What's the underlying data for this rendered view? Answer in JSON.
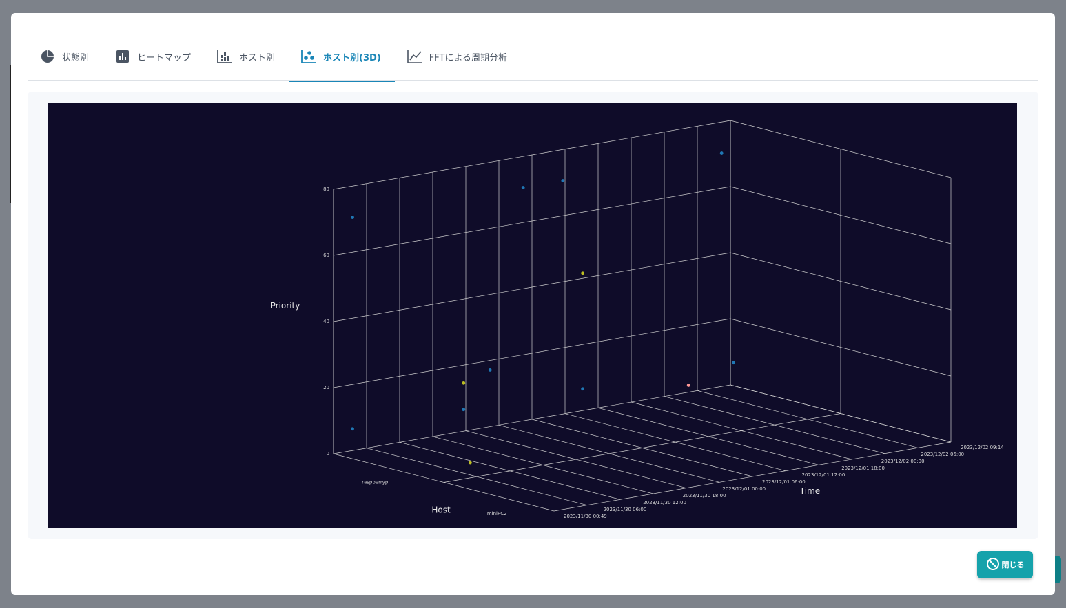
{
  "tabs": [
    {
      "label": "状態別",
      "icon": "pie-chart-icon",
      "active": false
    },
    {
      "label": "ヒートマップ",
      "icon": "bar-chart-icon",
      "active": false
    },
    {
      "label": "ホスト別",
      "icon": "stacked-bar-icon",
      "active": false
    },
    {
      "label": "ホスト別(3D)",
      "icon": "scatter-3d-icon",
      "active": true
    },
    {
      "label": "FFTによる周期分析",
      "icon": "line-chart-icon",
      "active": false
    }
  ],
  "chart_data": {
    "type": "scatter",
    "background": "#0f0c29",
    "axes": {
      "priority": {
        "title": "Priority",
        "ticks": [
          "0",
          "20",
          "40",
          "60",
          "80"
        ],
        "range": [
          0,
          80
        ]
      },
      "host": {
        "title": "Host",
        "categories": [
          "raspberrypi",
          "miniPC2"
        ]
      },
      "time": {
        "title": "Time",
        "ticks": [
          "2023/11/30 00:49",
          "2023/11/30 06:00",
          "2023/11/30 12:00",
          "2023/11/30 18:00",
          "2023/12/01 00:00",
          "2023/12/01 06:00",
          "2023/12/01 12:00",
          "2023/12/01 18:00",
          "2023/12/02 00:00",
          "2023/12/02 06:00",
          "2023/12/02 09:14"
        ]
      }
    },
    "series": [
      {
        "color": "#1f77b4",
        "points": [
          {
            "host": "raspberrypi",
            "time": 0.02,
            "priority": 8
          },
          {
            "host": "raspberrypi",
            "time": 0.3,
            "priority": 8
          },
          {
            "host": "raspberrypi",
            "time": 0.6,
            "priority": 8
          },
          {
            "host": "raspberrypi",
            "time": 0.98,
            "priority": 8
          },
          {
            "host": "raspberrypi",
            "time": 0.02,
            "priority": 72
          },
          {
            "host": "raspberrypi",
            "time": 0.45,
            "priority": 72
          },
          {
            "host": "raspberrypi",
            "time": 0.55,
            "priority": 72
          },
          {
            "host": "raspberrypi",
            "time": 0.95,
            "priority": 72
          },
          {
            "host": "miniPC2",
            "time": 0.05,
            "priority": 35
          }
        ]
      },
      {
        "color": "#bcbd22",
        "points": [
          {
            "host": "raspberrypi",
            "time": 0.6,
            "priority": 43
          },
          {
            "host": "raspberrypi",
            "time": 0.3,
            "priority": 16
          },
          {
            "host": "miniPC2",
            "time": 0.0,
            "priority": 8
          }
        ]
      },
      {
        "color": "#ff9896",
        "points": [
          {
            "host": "miniPC2",
            "time": 0.55,
            "priority": 20
          }
        ]
      }
    ]
  },
  "close_button": {
    "label": "閉じる",
    "icon": "ban-icon"
  }
}
